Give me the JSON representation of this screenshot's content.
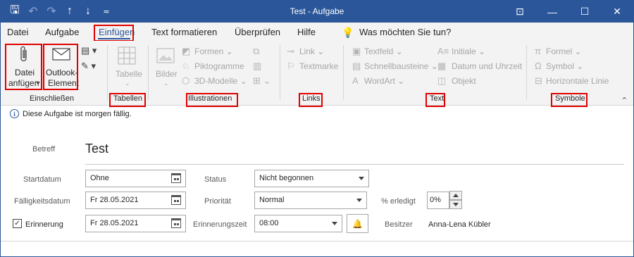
{
  "window": {
    "title": "Test - Aufgabe",
    "qat": {
      "save_icon": "save-icon",
      "undo_icon": "undo-icon",
      "redo_icon": "redo-icon",
      "up_icon": "arrow-up-icon",
      "down_icon": "arrow-down-icon",
      "customize_icon": "customize-icon"
    },
    "accent": "#2b579a"
  },
  "menu": {
    "items": [
      "Datei",
      "Aufgabe",
      "Einfügen",
      "Text formatieren",
      "Überprüfen",
      "Hilfe"
    ],
    "active": "Einfügen",
    "tell_me": "Was möchten Sie tun?"
  },
  "ribbon": {
    "einschliessen": {
      "label": "Einschließen",
      "attach_l1": "Datei",
      "attach_l2": "anfügen",
      "outlook_l1": "Outlook-",
      "outlook_l2": "Element"
    },
    "tabellen": {
      "label": "Tabellen",
      "tabelle": "Tabelle"
    },
    "illustrationen": {
      "label": "Illustrationen",
      "bilder": "Bilder",
      "formen": "Formen",
      "piktogramme": "Piktogramme",
      "modelle": "3D-Modelle"
    },
    "links": {
      "label": "Links",
      "link": "Link",
      "textmarke": "Textmarke"
    },
    "text": {
      "label": "Text",
      "textfeld": "Textfeld",
      "schnellbausteine": "Schnellbausteine",
      "wordart": "WordArt",
      "initiale": "Initiale",
      "datum": "Datum und Uhrzeit",
      "objekt": "Objekt"
    },
    "symbole": {
      "label": "Symbole",
      "formel": "Formel",
      "symbol": "Symbol",
      "linie": "Horizontale Linie"
    }
  },
  "form": {
    "info": "Diese Aufgabe ist morgen fällig.",
    "betreff_label": "Betreff",
    "betreff_value": "Test",
    "startdatum_label": "Startdatum",
    "startdatum_value": "Ohne",
    "faellig_label": "Fälligkeitsdatum",
    "faellig_value": "Fr 28.05.2021",
    "erinnerung_label": "Erinnerung",
    "erinnerung_value": "Fr 28.05.2021",
    "erinnerung_checked": true,
    "status_label": "Status",
    "status_value": "Nicht begonnen",
    "prioritaet_label": "Priorität",
    "prioritaet_value": "Normal",
    "erinnerungszeit_label": "Erinnerungszeit",
    "erinnerungszeit_value": "08:00",
    "erledigt_label": "% erledigt",
    "erledigt_value": "0%",
    "besitzer_label": "Besitzer",
    "besitzer_value": "Anna-Lena Kübler"
  }
}
